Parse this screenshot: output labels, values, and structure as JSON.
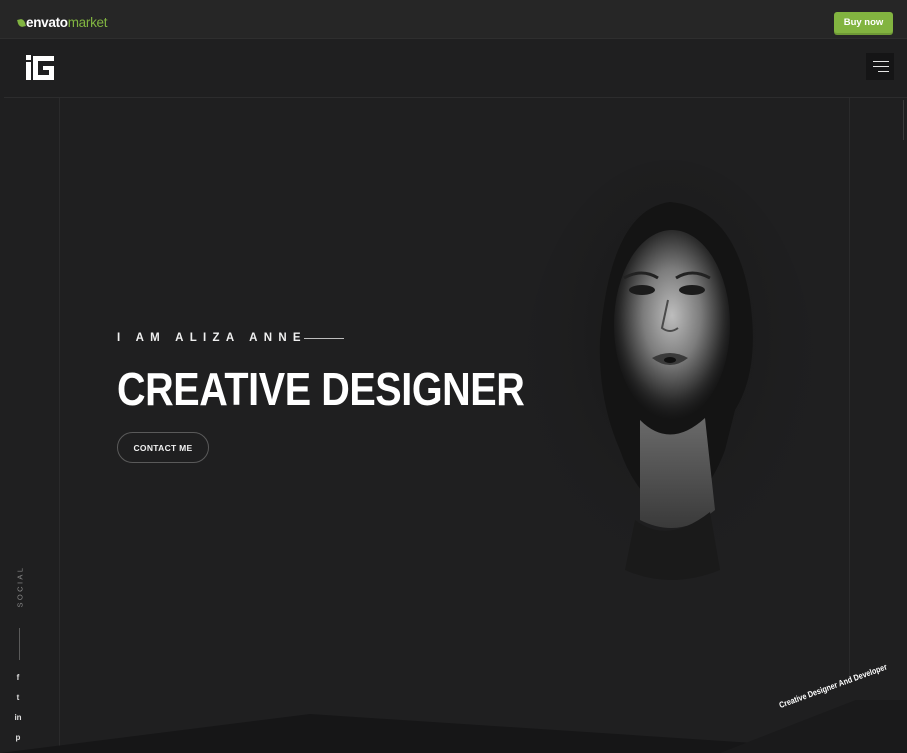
{
  "envato": {
    "logo_word1": "envato",
    "logo_word2": "market",
    "buy_label": "Buy now"
  },
  "header": {
    "logo_icon": "brand-logo-icon",
    "menu_icon": "hamburger-menu-icon"
  },
  "sidebar": {
    "social_label": "SOCIAL",
    "icons": [
      {
        "name": "facebook-icon",
        "glyph": "f"
      },
      {
        "name": "twitter-icon",
        "glyph": "t"
      },
      {
        "name": "linkedin-icon",
        "glyph": "in"
      },
      {
        "name": "pinterest-icon",
        "glyph": "p"
      }
    ]
  },
  "hero": {
    "intro": "I AM ALIZA ANNE",
    "title": "CREATIVE DESIGNER",
    "cta_label": "CONTACT ME",
    "tagline": "Creative Designer And Developer"
  },
  "colors": {
    "background": "#1f1f20",
    "envato_green": "#82b440",
    "text": "#ffffff"
  }
}
